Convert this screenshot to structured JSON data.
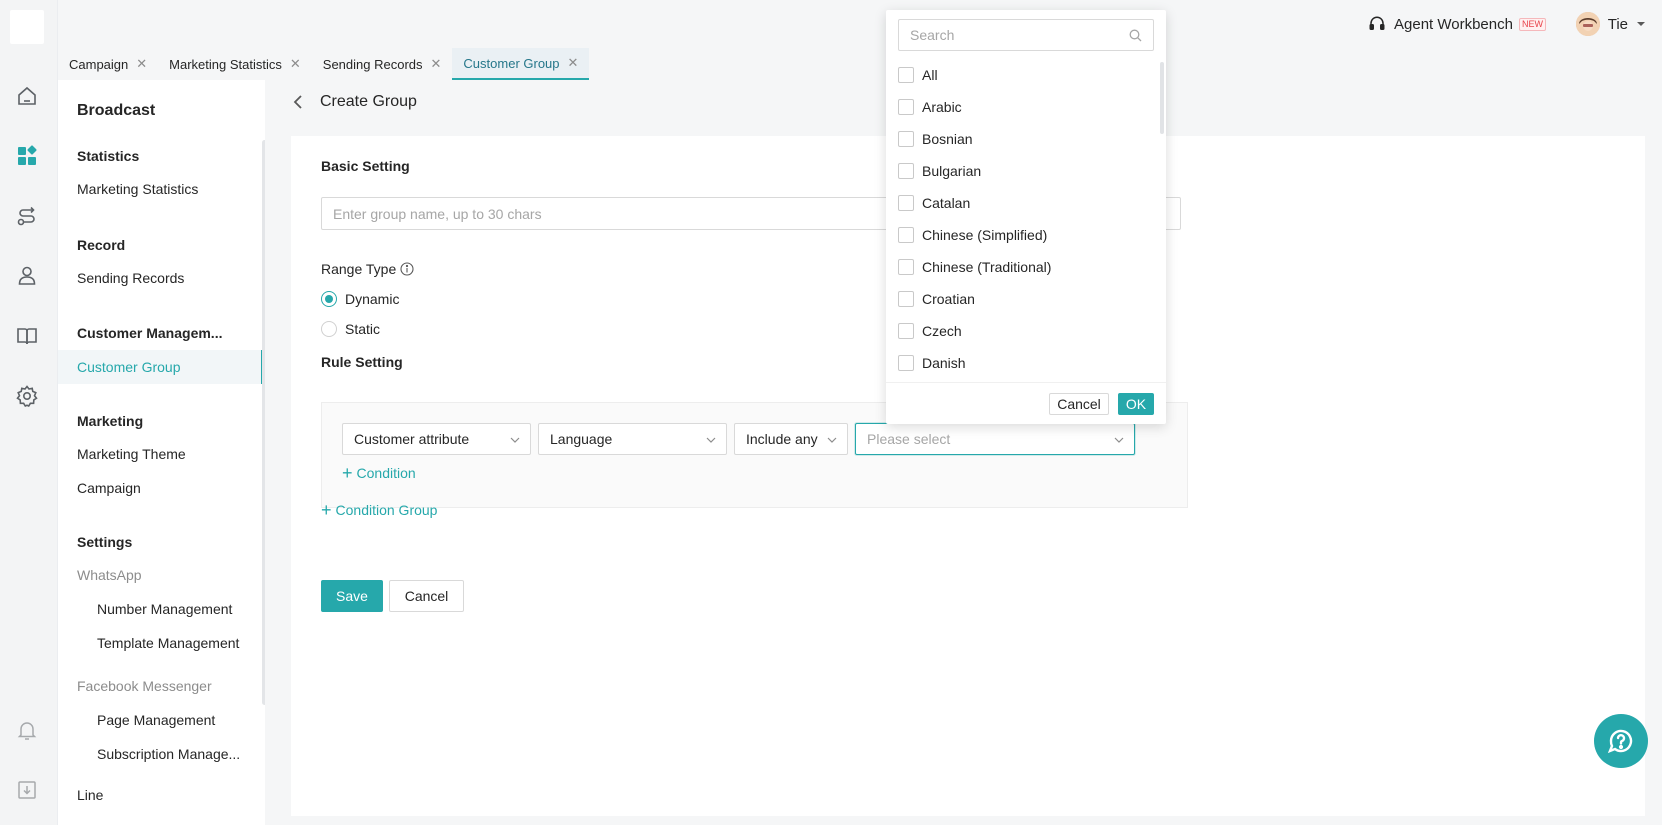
{
  "colors": {
    "accent": "#26a8ab",
    "new_badge": "#e8434a"
  },
  "topbar": {
    "workbench_label": "Agent Workbench",
    "workbench_badge": "NEW",
    "user_name": "Tie"
  },
  "tabs": [
    {
      "label": "Campaign"
    },
    {
      "label": "Marketing Statistics"
    },
    {
      "label": "Sending Records"
    },
    {
      "label": "Customer Group",
      "active": true
    }
  ],
  "rail_icons": [
    "home-icon",
    "dashboard-icon",
    "route-icon",
    "contacts-icon",
    "book-icon",
    "settings-icon",
    "bell-icon",
    "download-icon"
  ],
  "sidebar": {
    "title": "Broadcast",
    "groups": {
      "statistics": "Statistics",
      "record": "Record",
      "customer_management": "Customer Managem...",
      "marketing": "Marketing",
      "settings": "Settings",
      "whatsapp": "WhatsApp",
      "facebook": "Facebook Messenger",
      "line": "Line"
    },
    "items": {
      "marketing_statistics": "Marketing Statistics",
      "sending_records": "Sending Records",
      "customer_group": "Customer Group",
      "marketing_theme": "Marketing Theme",
      "campaign": "Campaign",
      "number_management": "Number Management",
      "template_management": "Template Management",
      "page_management": "Page Management",
      "subscription_management": "Subscription Manage..."
    }
  },
  "page": {
    "title": "Create Group",
    "basic_setting": "Basic Setting",
    "group_name_placeholder": "Enter group name, up to 30 chars",
    "range_type_label": "Range Type",
    "range_options": [
      {
        "label": "Dynamic",
        "checked": true
      },
      {
        "label": "Static",
        "checked": false
      }
    ],
    "rule_setting": "Rule Setting",
    "rule": {
      "attribute_type": "Customer attribute",
      "attribute": "Language",
      "operator": "Include any",
      "value_placeholder": "Please select"
    },
    "add_condition": "Condition",
    "add_condition_group": "Condition Group",
    "save_label": "Save",
    "cancel_label": "Cancel"
  },
  "dropdown": {
    "search_placeholder": "Search",
    "options": [
      "All",
      "Arabic",
      "Bosnian",
      "Bulgarian",
      "Catalan",
      "Chinese (Simplified)",
      "Chinese (Traditional)",
      "Croatian",
      "Czech",
      "Danish"
    ],
    "cancel_label": "Cancel",
    "ok_label": "OK"
  }
}
